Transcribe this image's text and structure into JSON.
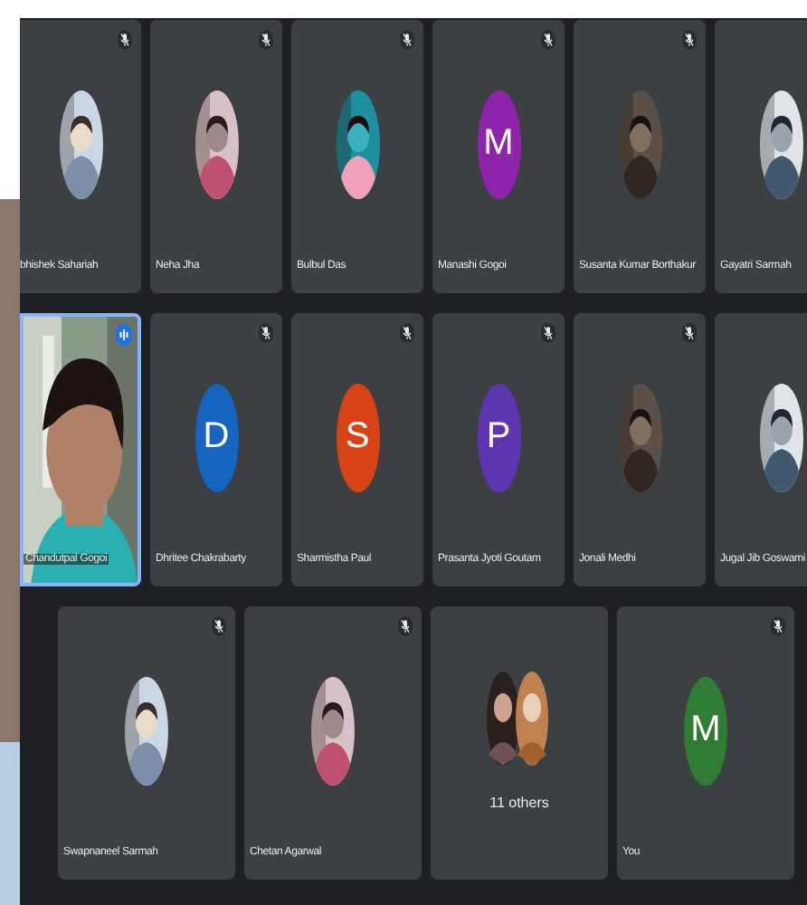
{
  "rows": [
    {
      "tiles": [
        {
          "name": "bhishek Sahariah",
          "muted": true,
          "speaking": false
        },
        {
          "name": "Neha Jha",
          "muted": true,
          "speaking": false
        },
        {
          "name": "Bulbul Das",
          "muted": true,
          "speaking": false
        },
        {
          "kind": "letter",
          "letter": "M",
          "color": "#8e24aa",
          "name": "Manashi Gogoi",
          "muted": true,
          "speaking": false
        },
        {
          "name": "Susanta Kumar Borthakur",
          "muted": true,
          "speaking": false
        },
        {
          "name": "Gayatri Sarmah",
          "muted": false,
          "speaking": false
        }
      ]
    },
    {
      "tiles": [
        {
          "kind": "video",
          "name": "Chandutpal Gogoi",
          "muted": false,
          "speaking": true
        },
        {
          "kind": "letter",
          "letter": "D",
          "color": "#1565c0",
          "name": "Dhritee Chakrabarty",
          "muted": true,
          "speaking": false
        },
        {
          "kind": "letter",
          "letter": "S",
          "color": "#d84315",
          "name": "Sharmistha Paul",
          "muted": true,
          "speaking": false
        },
        {
          "kind": "letter",
          "letter": "P",
          "color": "#5e35b1",
          "name": "Prasanta Jyoti Goutam",
          "muted": true,
          "speaking": false
        },
        {
          "name": "Jonali Medhi",
          "muted": true,
          "speaking": false
        },
        {
          "name": "Jugal Jib Goswami",
          "muted": false,
          "speaking": false
        }
      ]
    },
    {
      "tiles": [
        {
          "name": "Swapnaneel Sarmah",
          "muted": true,
          "speaking": false
        },
        {
          "name": "Chetan Agarwal",
          "muted": true,
          "speaking": false
        },
        {
          "kind": "others",
          "name": "11 others",
          "muted": false,
          "speaking": false
        },
        {
          "kind": "letter",
          "letter": "M",
          "color": "#2e7d32",
          "name": "You",
          "muted": true,
          "speaking": false
        }
      ]
    }
  ]
}
